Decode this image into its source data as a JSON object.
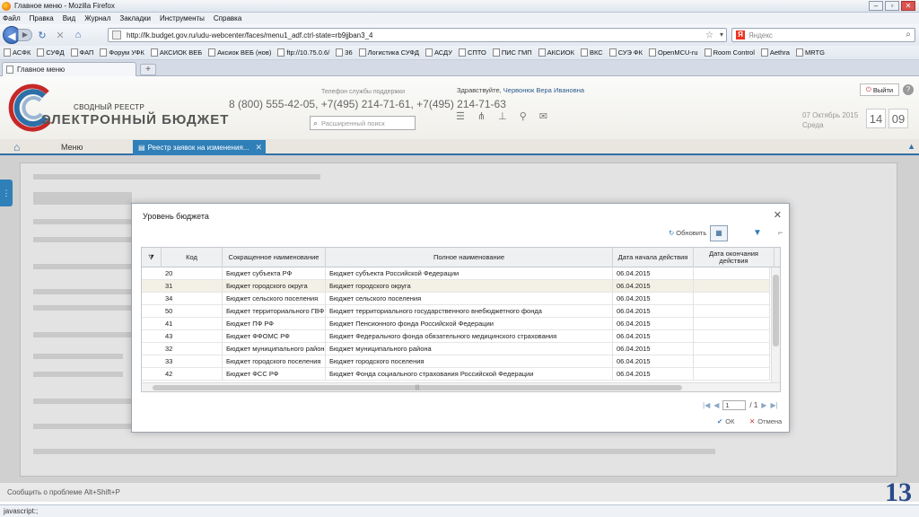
{
  "browser": {
    "title": "Главное меню - Mozilla Firefox",
    "menu": [
      "Файл",
      "Правка",
      "Вид",
      "Журнал",
      "Закладки",
      "Инструменты",
      "Справка"
    ],
    "url": "http://lk.budget.gov.ru/udu-webcenter/faces/menu1_adf.ctrl-state=rb9jjban3_4",
    "search_placeholder": "Яндекс",
    "bookmarks": [
      "АСФК",
      "СУФД",
      "ФАП",
      "Форум УФК",
      "АКСИОК ВЕБ",
      "Аксиок ВЕБ (нов)",
      "ftp://10.75.0.6/",
      "36",
      "Логистика СУФД",
      "АСДУ",
      "СПТО",
      "ПИС ГМП",
      "АКСИОК",
      "ВКС",
      "СУЭ ФК",
      "OpenMCU-ru",
      "Room Control",
      "Aethra",
      "MRTG"
    ],
    "tab_label": "Главное меню",
    "status_text": "javascript:;"
  },
  "app": {
    "logo_sub": "СВОДНЫЙ РЕЕСТР",
    "logo_main": "ЭЛЕКТРОННЫЙ БЮДЖЕТ",
    "support_label": "Телефон службы поддержки",
    "phones": "8 (800) 555-42-05, +7(495) 214-71-61, +7(495) 214-71-63",
    "search_placeholder": "Расширенный поиск",
    "greeting_prefix": "Здравствуйте,",
    "user_name": "Червонюк Вера Ивановна",
    "exit_label": "Выйти",
    "date_line1": "07 Октябрь 2015",
    "date_line2": "Среда",
    "clock_h": "14",
    "clock_m": "09",
    "nav_menu": "Меню",
    "active_tab": "Реестр заявок на изменения..."
  },
  "modal": {
    "title": "Уровень бюджета",
    "refresh_label": "Обновить",
    "columns": {
      "code": "Код",
      "short": "Сокращенное наименование",
      "full": "Полное наименование",
      "start": "Дата начала действия",
      "end": "Дата окончания действия"
    },
    "rows": [
      {
        "code": "20",
        "short": "Бюджет субъекта РФ",
        "full": "Бюджет субъекта Российской Федерации",
        "start": "06.04.2015",
        "end": ""
      },
      {
        "code": "31",
        "short": "Бюджет городского округа",
        "full": "Бюджет городского округа",
        "start": "06.04.2015",
        "end": ""
      },
      {
        "code": "34",
        "short": "Бюджет сельского поселения",
        "full": "Бюджет сельского поселения",
        "start": "06.04.2015",
        "end": ""
      },
      {
        "code": "50",
        "short": "Бюджет территориального ГВФ",
        "full": "Бюджет территориального государственного внебюджетного фонда",
        "start": "06.04.2015",
        "end": ""
      },
      {
        "code": "41",
        "short": "Бюджет ПФ РФ",
        "full": "Бюджет Пенсионного фонда Российской Федерации",
        "start": "06.04.2015",
        "end": ""
      },
      {
        "code": "43",
        "short": "Бюджет ФФОМС РФ",
        "full": "Бюджет Федерального фонда обязательного медицинского страхования",
        "start": "06.04.2015",
        "end": ""
      },
      {
        "code": "32",
        "short": "Бюджет муниципального района",
        "full": "Бюджет муниципального района",
        "start": "06.04.2015",
        "end": ""
      },
      {
        "code": "33",
        "short": "Бюджет городского поселения",
        "full": "Бюджет городского поселения",
        "start": "06.04.2015",
        "end": ""
      },
      {
        "code": "42",
        "short": "Бюджет ФСС РФ",
        "full": "Бюджет Фонда социального страхования Российской Федерации",
        "start": "06.04.2015",
        "end": ""
      }
    ],
    "selected_row": 1,
    "pager_current": "1",
    "pager_total": "/ 1",
    "ok_label": "ОК",
    "cancel_label": "Отмена"
  },
  "footer": {
    "report_text": "Сообщить о проблеме Alt+Shift+P",
    "slide_number": "13"
  }
}
